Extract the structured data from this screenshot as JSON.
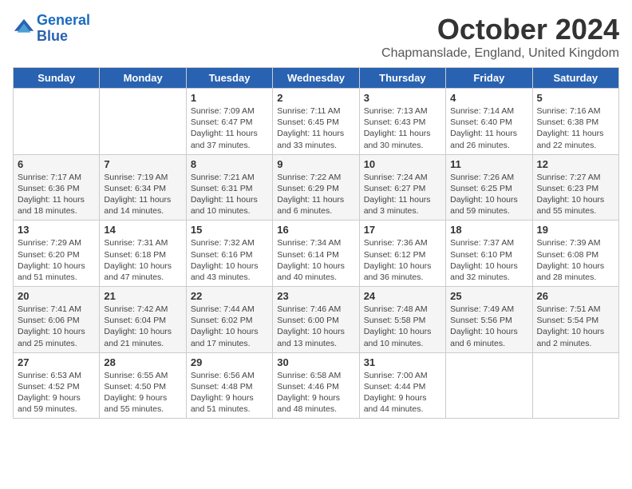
{
  "logo": {
    "name_part1": "General",
    "name_part2": "Blue"
  },
  "title": "October 2024",
  "location": "Chapmanslade, England, United Kingdom",
  "days_of_week": [
    "Sunday",
    "Monday",
    "Tuesday",
    "Wednesday",
    "Thursday",
    "Friday",
    "Saturday"
  ],
  "weeks": [
    [
      {
        "day": "",
        "info": ""
      },
      {
        "day": "",
        "info": ""
      },
      {
        "day": "1",
        "info": "Sunrise: 7:09 AM\nSunset: 6:47 PM\nDaylight: 11 hours and 37 minutes."
      },
      {
        "day": "2",
        "info": "Sunrise: 7:11 AM\nSunset: 6:45 PM\nDaylight: 11 hours and 33 minutes."
      },
      {
        "day": "3",
        "info": "Sunrise: 7:13 AM\nSunset: 6:43 PM\nDaylight: 11 hours and 30 minutes."
      },
      {
        "day": "4",
        "info": "Sunrise: 7:14 AM\nSunset: 6:40 PM\nDaylight: 11 hours and 26 minutes."
      },
      {
        "day": "5",
        "info": "Sunrise: 7:16 AM\nSunset: 6:38 PM\nDaylight: 11 hours and 22 minutes."
      }
    ],
    [
      {
        "day": "6",
        "info": "Sunrise: 7:17 AM\nSunset: 6:36 PM\nDaylight: 11 hours and 18 minutes."
      },
      {
        "day": "7",
        "info": "Sunrise: 7:19 AM\nSunset: 6:34 PM\nDaylight: 11 hours and 14 minutes."
      },
      {
        "day": "8",
        "info": "Sunrise: 7:21 AM\nSunset: 6:31 PM\nDaylight: 11 hours and 10 minutes."
      },
      {
        "day": "9",
        "info": "Sunrise: 7:22 AM\nSunset: 6:29 PM\nDaylight: 11 hours and 6 minutes."
      },
      {
        "day": "10",
        "info": "Sunrise: 7:24 AM\nSunset: 6:27 PM\nDaylight: 11 hours and 3 minutes."
      },
      {
        "day": "11",
        "info": "Sunrise: 7:26 AM\nSunset: 6:25 PM\nDaylight: 10 hours and 59 minutes."
      },
      {
        "day": "12",
        "info": "Sunrise: 7:27 AM\nSunset: 6:23 PM\nDaylight: 10 hours and 55 minutes."
      }
    ],
    [
      {
        "day": "13",
        "info": "Sunrise: 7:29 AM\nSunset: 6:20 PM\nDaylight: 10 hours and 51 minutes."
      },
      {
        "day": "14",
        "info": "Sunrise: 7:31 AM\nSunset: 6:18 PM\nDaylight: 10 hours and 47 minutes."
      },
      {
        "day": "15",
        "info": "Sunrise: 7:32 AM\nSunset: 6:16 PM\nDaylight: 10 hours and 43 minutes."
      },
      {
        "day": "16",
        "info": "Sunrise: 7:34 AM\nSunset: 6:14 PM\nDaylight: 10 hours and 40 minutes."
      },
      {
        "day": "17",
        "info": "Sunrise: 7:36 AM\nSunset: 6:12 PM\nDaylight: 10 hours and 36 minutes."
      },
      {
        "day": "18",
        "info": "Sunrise: 7:37 AM\nSunset: 6:10 PM\nDaylight: 10 hours and 32 minutes."
      },
      {
        "day": "19",
        "info": "Sunrise: 7:39 AM\nSunset: 6:08 PM\nDaylight: 10 hours and 28 minutes."
      }
    ],
    [
      {
        "day": "20",
        "info": "Sunrise: 7:41 AM\nSunset: 6:06 PM\nDaylight: 10 hours and 25 minutes."
      },
      {
        "day": "21",
        "info": "Sunrise: 7:42 AM\nSunset: 6:04 PM\nDaylight: 10 hours and 21 minutes."
      },
      {
        "day": "22",
        "info": "Sunrise: 7:44 AM\nSunset: 6:02 PM\nDaylight: 10 hours and 17 minutes."
      },
      {
        "day": "23",
        "info": "Sunrise: 7:46 AM\nSunset: 6:00 PM\nDaylight: 10 hours and 13 minutes."
      },
      {
        "day": "24",
        "info": "Sunrise: 7:48 AM\nSunset: 5:58 PM\nDaylight: 10 hours and 10 minutes."
      },
      {
        "day": "25",
        "info": "Sunrise: 7:49 AM\nSunset: 5:56 PM\nDaylight: 10 hours and 6 minutes."
      },
      {
        "day": "26",
        "info": "Sunrise: 7:51 AM\nSunset: 5:54 PM\nDaylight: 10 hours and 2 minutes."
      }
    ],
    [
      {
        "day": "27",
        "info": "Sunrise: 6:53 AM\nSunset: 4:52 PM\nDaylight: 9 hours and 59 minutes."
      },
      {
        "day": "28",
        "info": "Sunrise: 6:55 AM\nSunset: 4:50 PM\nDaylight: 9 hours and 55 minutes."
      },
      {
        "day": "29",
        "info": "Sunrise: 6:56 AM\nSunset: 4:48 PM\nDaylight: 9 hours and 51 minutes."
      },
      {
        "day": "30",
        "info": "Sunrise: 6:58 AM\nSunset: 4:46 PM\nDaylight: 9 hours and 48 minutes."
      },
      {
        "day": "31",
        "info": "Sunrise: 7:00 AM\nSunset: 4:44 PM\nDaylight: 9 hours and 44 minutes."
      },
      {
        "day": "",
        "info": ""
      },
      {
        "day": "",
        "info": ""
      }
    ]
  ]
}
